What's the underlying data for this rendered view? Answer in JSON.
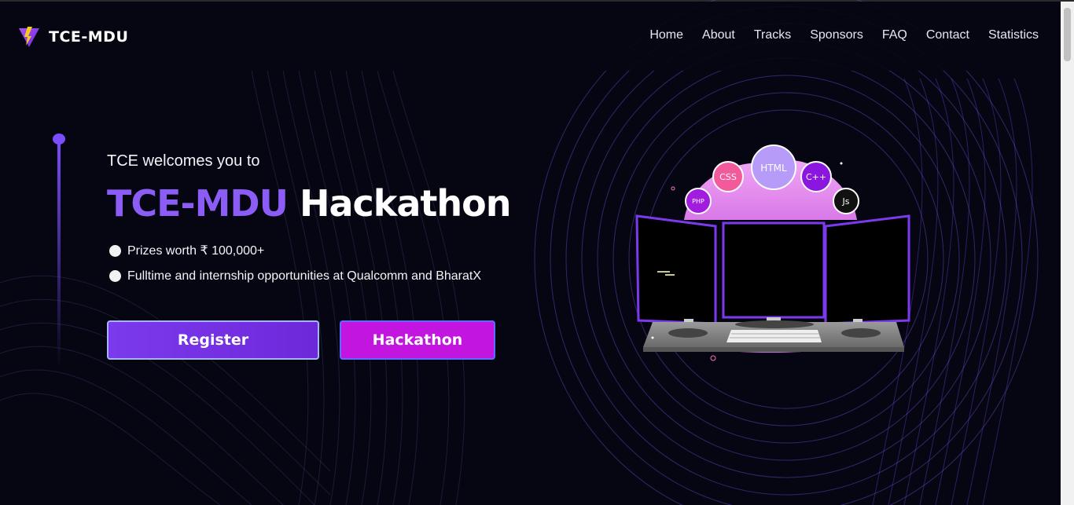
{
  "brand": {
    "name": "TCE-MDU",
    "logo_icon": "v-logo-icon"
  },
  "nav": {
    "items": [
      {
        "label": "Home"
      },
      {
        "label": "About"
      },
      {
        "label": "Tracks"
      },
      {
        "label": "Sponsors"
      },
      {
        "label": "FAQ"
      },
      {
        "label": "Contact"
      },
      {
        "label": "Statistics"
      }
    ]
  },
  "hero": {
    "welcome": "TCE welcomes you to",
    "title_accent": "TCE-MDU",
    "title_main": "Hackathon",
    "bullets": [
      "Prizes worth ₹ 100,000+",
      "Fulltime and internship opportunities at Qualcomm and BharatX"
    ],
    "register_label": "Register",
    "hackathon_label": "Hackathon"
  },
  "illustration": {
    "bubbles": [
      "HTML",
      "CSS",
      "C++",
      "PHP",
      "Js"
    ]
  },
  "colors": {
    "accent": "#8b5cf6",
    "background": "#060612",
    "register": "#7c3aed",
    "hackathon": "#c216e0"
  }
}
